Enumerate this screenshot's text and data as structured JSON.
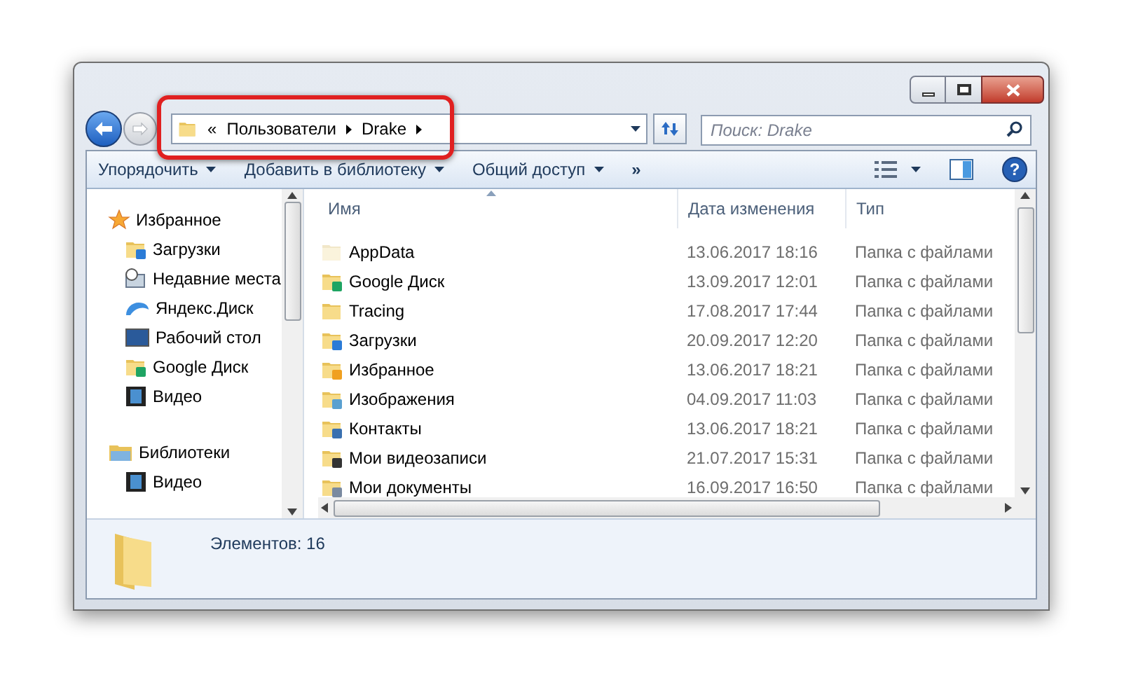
{
  "address": {
    "overflow": "«",
    "crumbs": [
      "Пользователи",
      "Drake"
    ]
  },
  "search": {
    "placeholder": "Поиск: Drake"
  },
  "toolbar": {
    "items": [
      {
        "label": "Упорядочить"
      },
      {
        "label": "Добавить в библиотеку"
      },
      {
        "label": "Общий доступ"
      }
    ],
    "more": "»",
    "help": "?"
  },
  "sidebar": {
    "groups": [
      {
        "label": "Избранное",
        "kind": "star",
        "items": [
          {
            "label": "Загрузки",
            "kind": "download"
          },
          {
            "label": "Недавние места",
            "kind": "recent"
          },
          {
            "label": "Яндекс.Диск",
            "kind": "cloud"
          },
          {
            "label": "Рабочий стол",
            "kind": "desktop"
          },
          {
            "label": "Google Диск",
            "kind": "gdrive"
          },
          {
            "label": "Видео",
            "kind": "video"
          }
        ]
      },
      {
        "label": "Библиотеки",
        "kind": "library",
        "items": [
          {
            "label": "Видео",
            "kind": "video"
          }
        ]
      }
    ]
  },
  "table": {
    "columns": [
      {
        "label": "Имя",
        "sorted": true
      },
      {
        "label": "Дата изменения",
        "sorted": false
      },
      {
        "label": "Тип",
        "sorted": false
      }
    ],
    "rows": [
      {
        "name": "AppData",
        "date": "13.06.2017 18:16",
        "type": "Папка с файлами",
        "kind": "hidden"
      },
      {
        "name": "Google Диск",
        "date": "13.09.2017 12:01",
        "type": "Папка с файлами",
        "kind": "gdrive"
      },
      {
        "name": "Tracing",
        "date": "17.08.2017 17:44",
        "type": "Папка с файлами",
        "kind": "folder"
      },
      {
        "name": "Загрузки",
        "date": "20.09.2017 12:20",
        "type": "Папка с файлами",
        "kind": "download"
      },
      {
        "name": "Избранное",
        "date": "13.06.2017 18:21",
        "type": "Папка с файлами",
        "kind": "star"
      },
      {
        "name": "Изображения",
        "date": "04.09.2017 11:03",
        "type": "Папка с файлами",
        "kind": "picture"
      },
      {
        "name": "Контакты",
        "date": "13.06.2017 18:21",
        "type": "Папка с файлами",
        "kind": "contacts"
      },
      {
        "name": "Мои видеозаписи",
        "date": "21.07.2017 15:31",
        "type": "Папка с файлами",
        "kind": "video"
      },
      {
        "name": "Мои документы",
        "date": "16.09.2017 16:50",
        "type": "Папка с файлами",
        "kind": "document"
      }
    ]
  },
  "status_bar": {
    "text": "Элементов: 16"
  }
}
